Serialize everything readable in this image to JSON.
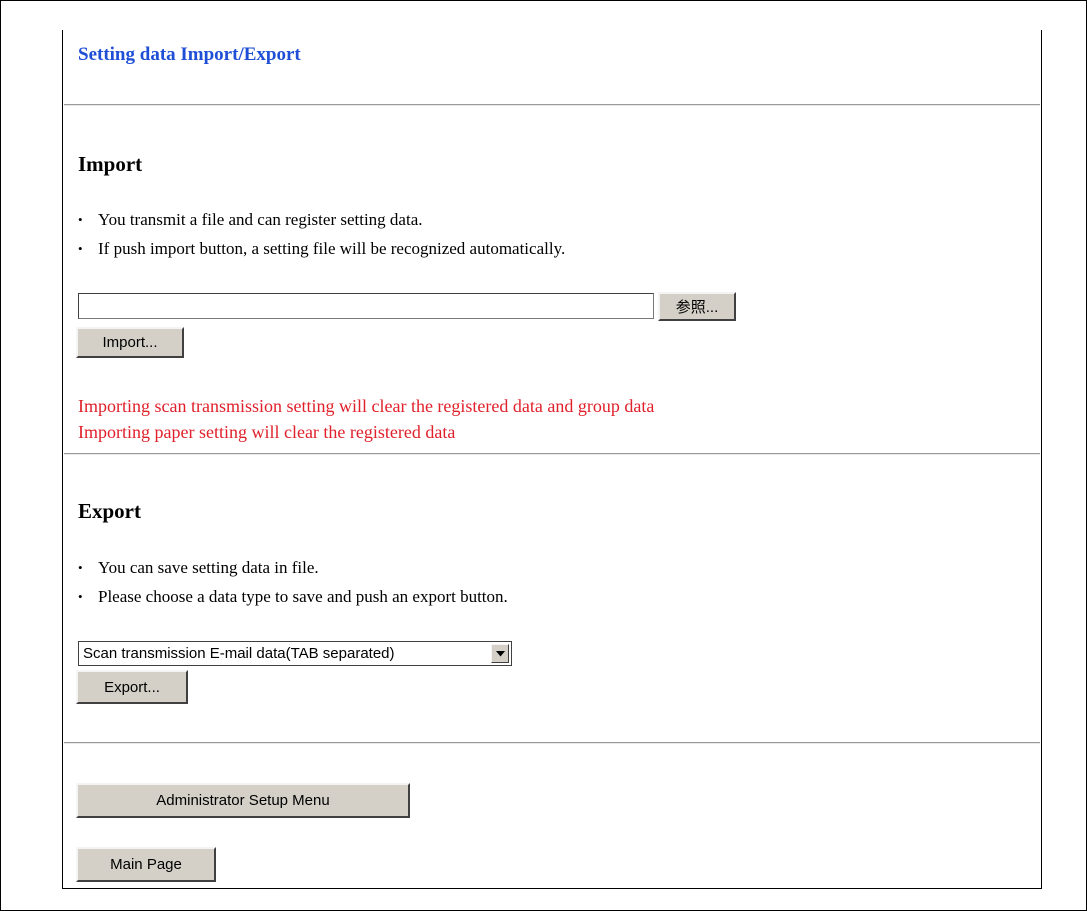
{
  "page_title": "Setting data Import/Export",
  "import": {
    "heading": "Import",
    "bullets": [
      "You transmit a file and can register setting data.",
      "If push import button, a setting file will be recognized automatically."
    ],
    "file_value": "",
    "browse_label": "参照...",
    "import_label": "Import...",
    "warnings": [
      "Importing scan transmission setting will clear the registered data and group data",
      "Importing paper setting will clear the registered data"
    ],
    "warning_color": "#e0202a"
  },
  "export": {
    "heading": "Export",
    "bullets": [
      "You can save setting data in file.",
      "Please choose a data type to save and push an export button."
    ],
    "data_type_selected": "Scan transmission E-mail data(TAB separated)",
    "export_label": "Export..."
  },
  "nav": {
    "admin_menu_label": "Administrator Setup Menu",
    "main_page_label": "Main Page"
  },
  "colors": {
    "title": "#1f4fd6",
    "button_face": "#d4d0c8"
  },
  "icons": {
    "dropdown": "chevron-down-icon"
  }
}
